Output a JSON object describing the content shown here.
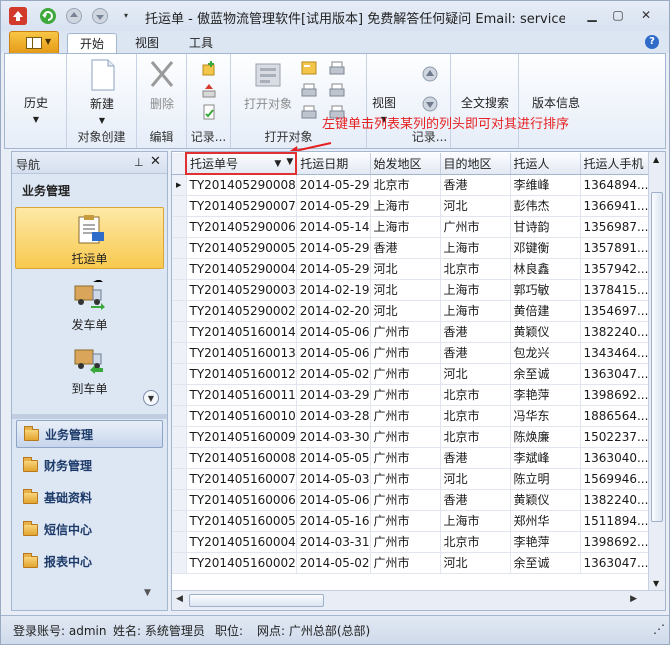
{
  "window": {
    "title": "托运单 - 傲蓝物流管理软件[试用版本] 免费解答任何疑问 Email: service@lan..."
  },
  "ribbon": {
    "tabs": [
      "开始",
      "视图",
      "工具"
    ],
    "groups": {
      "history": {
        "label": "历史"
      },
      "create": {
        "new_label": "新建",
        "group_label": "对象创建"
      },
      "edit": {
        "delete_label": "删除",
        "group_label": "编辑"
      },
      "record": {
        "group_label": "记录..."
      },
      "open": {
        "open_label": "打开对象",
        "view_label": "视图",
        "group_label": "打开对象"
      },
      "record2": {
        "group_label": "记录..."
      },
      "search": {
        "fulltext_label": "全文搜索"
      },
      "version": {
        "label": "版本信息"
      }
    }
  },
  "annotation": "左键单击列表某列的列头即可对其进行排序",
  "nav": {
    "title": "导航",
    "section": "业务管理",
    "tiles": [
      "托运单",
      "发车单",
      "到车单"
    ],
    "categories": [
      "业务管理",
      "财务管理",
      "基础资料",
      "短信中心",
      "报表中心"
    ]
  },
  "grid": {
    "columns": [
      "托运单号",
      "托运日期",
      "始发地区",
      "目的地区",
      "托运人",
      "托运人手机"
    ],
    "rows": [
      [
        "TY201405290008",
        "2014-05-29",
        "北京市",
        "香港",
        "李维峰",
        "1364894..."
      ],
      [
        "TY201405290007",
        "2014-05-29",
        "上海市",
        "河北",
        "彭伟杰",
        "1366941..."
      ],
      [
        "TY201405290006",
        "2014-05-14",
        "上海市",
        "广州市",
        "甘诗韵",
        "1356987..."
      ],
      [
        "TY201405290005",
        "2014-05-29",
        "香港",
        "上海市",
        "邓键衡",
        "1357891..."
      ],
      [
        "TY201405290004",
        "2014-05-29",
        "河北",
        "北京市",
        "林良鑫",
        "1357942..."
      ],
      [
        "TY201405290003",
        "2014-02-19",
        "河北",
        "上海市",
        "郭巧敏",
        "1378415..."
      ],
      [
        "TY201405290002",
        "2014-02-20",
        "河北",
        "上海市",
        "黄倍建",
        "1354697..."
      ],
      [
        "TY201405160014",
        "2014-05-06",
        "广州市",
        "香港",
        "黄颖仪",
        "1382240..."
      ],
      [
        "TY201405160013",
        "2014-05-06",
        "广州市",
        "香港",
        "包龙兴",
        "1343464..."
      ],
      [
        "TY201405160012",
        "2014-05-02",
        "广州市",
        "河北",
        "余至诚",
        "1363047..."
      ],
      [
        "TY201405160011",
        "2014-03-29",
        "广州市",
        "北京市",
        "李艳萍",
        "1398692..."
      ],
      [
        "TY201405160010",
        "2014-03-28",
        "广州市",
        "北京市",
        "冯华东",
        "1886564..."
      ],
      [
        "TY201405160009",
        "2014-03-30",
        "广州市",
        "北京市",
        "陈焕廉",
        "1502237..."
      ],
      [
        "TY201405160008",
        "2014-05-05",
        "广州市",
        "香港",
        "李斌峰",
        "1363040..."
      ],
      [
        "TY201405160007",
        "2014-05-03",
        "广州市",
        "河北",
        "陈立明",
        "1569946..."
      ],
      [
        "TY201405160006",
        "2014-05-06",
        "广州市",
        "香港",
        "黄颖仪",
        "1382240..."
      ],
      [
        "TY201405160005",
        "2014-05-16",
        "广州市",
        "上海市",
        "郑州华",
        "1511894..."
      ],
      [
        "TY201405160004",
        "2014-03-31",
        "广州市",
        "北京市",
        "李艳萍",
        "1398692..."
      ],
      [
        "TY201405160002",
        "2014-05-02",
        "广州市",
        "河北",
        "余至诚",
        "1363047..."
      ]
    ]
  },
  "status": {
    "account": "登录账号: admin",
    "name": "姓名: 系统管理员",
    "position": "职位:",
    "site": "网点: 广州总部(总部)"
  }
}
